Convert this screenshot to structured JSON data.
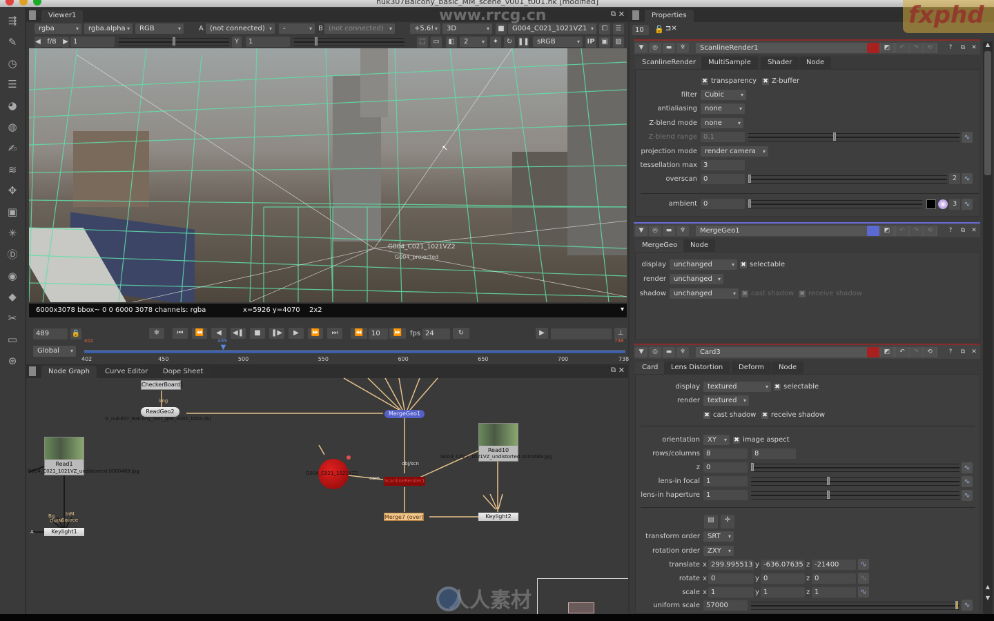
{
  "window": {
    "title": "nuk307Balcony_basic_MM_scene_v001_t001.nk [modified]",
    "traffic_colors": [
      "#e0443e",
      "#dea123",
      "#1aab29"
    ]
  },
  "watermarks": {
    "url": "www.rrcg.cn",
    "brand": "fxphd",
    "bottom_logo_text": "人人素材"
  },
  "left_toolbar": {
    "tools": [
      {
        "name": "image-icon",
        "glyph": "⇶"
      },
      {
        "name": "draw-icon",
        "glyph": "✎"
      },
      {
        "name": "time-icon",
        "glyph": "◷"
      },
      {
        "name": "channel-icon",
        "glyph": "☰"
      },
      {
        "name": "color-icon",
        "glyph": "◕"
      },
      {
        "name": "filter-icon",
        "glyph": "◍"
      },
      {
        "name": "keyer-icon",
        "glyph": "✍"
      },
      {
        "name": "merge-icon",
        "glyph": "≋"
      },
      {
        "name": "transform-icon",
        "glyph": "✥"
      },
      {
        "name": "3d-icon",
        "glyph": "▣"
      },
      {
        "name": "particles-icon",
        "glyph": "✳"
      },
      {
        "name": "deep-icon",
        "glyph": "Ⓓ"
      },
      {
        "name": "views-icon",
        "glyph": "◉"
      },
      {
        "name": "metadata-icon",
        "glyph": "◆"
      },
      {
        "name": "other-icon",
        "glyph": "✂"
      },
      {
        "name": "toolsets-icon",
        "glyph": "▭"
      },
      {
        "name": "furnace-icon",
        "glyph": "⊛"
      }
    ]
  },
  "viewer": {
    "tab_label": "Viewer1",
    "channels": "rgba",
    "alpha_channel": "rgba.alpha",
    "display": "RGB",
    "input_a_label": "A",
    "input_a": "(not connected)",
    "op": "-",
    "input_b_label": "B",
    "input_b": "(not connected)",
    "gain_display": "+5.6!",
    "view_mode": "3D",
    "camera": "G004_C021_1021VZ1",
    "fstop": "f/8",
    "gain_value": "1",
    "gamma_label": "Y",
    "gamma_value": "1",
    "proxy": "2",
    "lut": "sRGB",
    "ip_label": "IP",
    "camera_overlay_label": "G004_C021_1021VZ2",
    "camera_overlay_sub": "G004_projected",
    "info_bar": {
      "format": "6000x3078 bbox~ 0 0 6000 3078 channels: rgba",
      "coords": "x=5926 y=4070",
      "proxy": "2x2"
    }
  },
  "timeline": {
    "current_frame": "489",
    "increment": "10",
    "fps_label": "fps",
    "fps": "24",
    "range_mode": "Global",
    "start_frame": "402",
    "end_frame": "738",
    "playhead_frame": "489",
    "ticks": [
      "402",
      "450",
      "500",
      "550",
      "600",
      "650",
      "700",
      "738"
    ]
  },
  "node_graph": {
    "tabs": [
      "Node Graph",
      "Curve Editor",
      "Dope Sheet"
    ],
    "nodes": [
      {
        "id": "checkerboard1",
        "label": "CheckerBoard1"
      },
      {
        "id": "readgeo2",
        "label": "ReadGeo2",
        "sub": "G_nuk307_Balcony_test_geo_v001_t002.obj"
      },
      {
        "id": "mergegeo1",
        "label": "MergeGeo1"
      },
      {
        "id": "read1",
        "label": "Read1",
        "sub": "G004_C021_1021VZ_undistorted.0000489.jpg"
      },
      {
        "id": "keylight1",
        "label": "Keylight1"
      },
      {
        "id": "camera",
        "label": "G004_C021_1021VZ2"
      },
      {
        "id": "scanlinerender1",
        "label": "ScanlineRender1"
      },
      {
        "id": "read10",
        "label": "Read10",
        "sub": "G004_C021_1021VZ_undistorted.0000489.jpg"
      },
      {
        "id": "keylight2",
        "label": "Keylight2"
      },
      {
        "id": "merge7",
        "label": "Merge7 (over)"
      }
    ],
    "pins": {
      "img": "img",
      "obj_scn": "obj/scn",
      "cam": "cam",
      "bg": "Bg",
      "a": "A",
      "inm": "InM",
      "outm": "OutM",
      "source": "Source"
    }
  },
  "properties": {
    "tab_label": "Properties",
    "max_panels": "10",
    "panels": [
      {
        "name": "ScanlineRender1",
        "tabs": [
          "ScanlineRender",
          "MultiSample",
          "Shader",
          "Node"
        ],
        "checkboxes": [
          {
            "label": "transparency",
            "checked": true
          },
          {
            "label": "Z-buffer",
            "checked": true
          }
        ],
        "fields": {
          "filter": {
            "label": "filter",
            "value": "Cubic"
          },
          "antialiasing": {
            "label": "antialiasing",
            "value": "none"
          },
          "zblend_mode": {
            "label": "Z-blend mode",
            "value": "none"
          },
          "zblend_range": {
            "label": "Z-blend range",
            "value": "0.1"
          },
          "projection_mode": {
            "label": "projection mode",
            "value": "render camera"
          },
          "tessellation_max": {
            "label": "tessellation max",
            "value": "3"
          },
          "overscan": {
            "label": "overscan",
            "value": "0",
            "dims": "2"
          },
          "ambient": {
            "label": "ambient",
            "value": "0",
            "dims": "3"
          }
        },
        "zblend_range_fraction": 0.41
      },
      {
        "name": "MergeGeo1",
        "tabs": [
          "MergeGeo",
          "Node"
        ],
        "fields": {
          "display": {
            "label": "display",
            "value": "unchanged"
          },
          "render": {
            "label": "render",
            "value": "unchanged"
          },
          "shadow": {
            "label": "shadow",
            "value": "unchanged"
          }
        },
        "checkboxes": [
          {
            "label": "selectable",
            "checked": true
          },
          {
            "label": "cast shadow",
            "checked": true
          },
          {
            "label": "receive shadow",
            "checked": true
          }
        ]
      },
      {
        "name": "Card3",
        "tabs": [
          "Card",
          "Lens Distortion",
          "Deform",
          "Node"
        ],
        "fields": {
          "display": {
            "label": "display",
            "value": "textured"
          },
          "render": {
            "label": "render",
            "value": "textured"
          },
          "orientation": {
            "label": "orientation",
            "value": "XY"
          },
          "rows_columns": {
            "label": "rows/columns",
            "rows": "8",
            "columns": "8"
          },
          "z": {
            "label": "z",
            "value": "0"
          },
          "lens_in_focal": {
            "label": "lens-in focal",
            "value": "1"
          },
          "lens_in_haperture": {
            "label": "lens-in haperture",
            "value": "1"
          },
          "transform_order": {
            "label": "transform order",
            "value": "SRT"
          },
          "rotation_order": {
            "label": "rotation order",
            "value": "ZXY"
          },
          "translate": {
            "label": "translate",
            "x": "299.995513",
            "y": "-636.07635",
            "z": "-21400"
          },
          "rotate": {
            "label": "rotate",
            "x": "0",
            "y": "0",
            "z": "0"
          },
          "scale": {
            "label": "scale",
            "x": "1",
            "y": "1",
            "z": "1"
          },
          "uniform_scale": {
            "label": "uniform scale",
            "value": "57000"
          }
        },
        "checkboxes": [
          {
            "label": "selectable",
            "checked": true
          },
          {
            "label": "cast shadow",
            "checked": true
          },
          {
            "label": "receive shadow",
            "checked": true
          },
          {
            "label": "image aspect",
            "checked": true
          }
        ],
        "axis_labels": {
          "x": "x",
          "y": "y",
          "z": "z"
        }
      }
    ]
  }
}
